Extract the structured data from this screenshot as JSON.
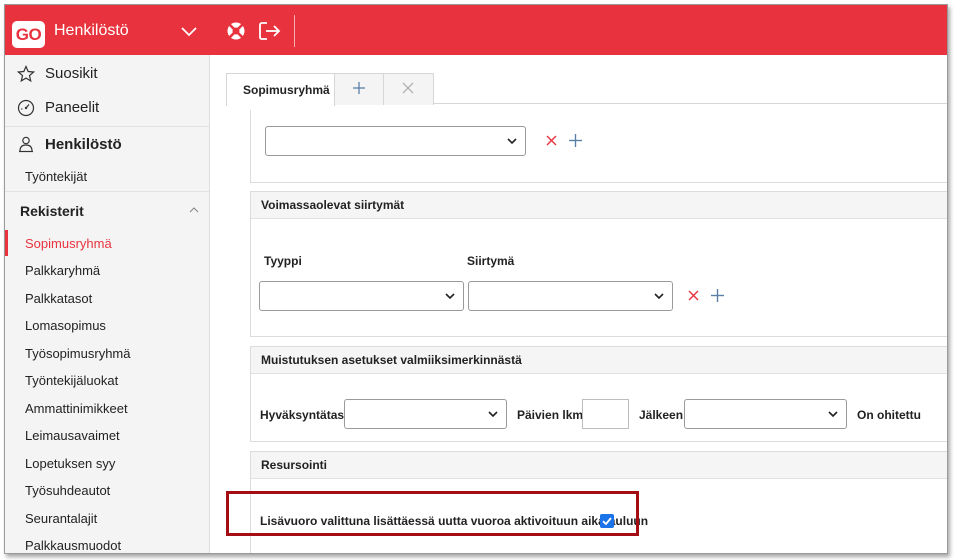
{
  "header": {
    "logo": "GO",
    "app_title": "Henkilöstö",
    "icons": [
      "chevron-down-icon",
      "lifebuoy-icon",
      "logout-icon"
    ]
  },
  "sidebar": {
    "top_items": [
      {
        "label": "Suosikit",
        "icon": "star-icon"
      },
      {
        "label": "Paneelit",
        "icon": "dashboard-icon"
      }
    ],
    "module": {
      "label": "Henkilöstö",
      "icon": "people-icon"
    },
    "module_items": [
      "Työntekijät"
    ],
    "section": {
      "label": "Rekisterit",
      "expanded": true
    },
    "items": [
      {
        "label": "Sopimusryhmä",
        "active": true
      },
      {
        "label": "Palkkaryhmä"
      },
      {
        "label": "Palkkatasot"
      },
      {
        "label": "Lomasopimus"
      },
      {
        "label": "Työsopimusryhmä"
      },
      {
        "label": "Työntekijäluokat"
      },
      {
        "label": "Ammattinimikkeet"
      },
      {
        "label": "Leimausavaimet"
      },
      {
        "label": "Lopetuksen syy"
      },
      {
        "label": "Työsuhdeautot"
      },
      {
        "label": "Seurantalajit"
      },
      {
        "label": "Palkkausmuodot"
      }
    ]
  },
  "tabs": [
    {
      "label": "Sopimusryhmä",
      "active": true
    },
    {
      "icon": "plus-icon"
    },
    {
      "icon": "close-icon"
    }
  ],
  "panels": {
    "top": {
      "select_value": ""
    },
    "transitions": {
      "title": "Voimassaolevat siirtymät",
      "type_label": "Tyyppi",
      "transition_label": "Siirtymä",
      "type_value": "",
      "transition_value": ""
    },
    "reminder": {
      "title": "Muistutuksen asetukset valmiiksimerkinnästä",
      "approval_label": "Hyväksyntätaso",
      "days_label": "Päivien lkm",
      "after_label": "Jälkeen",
      "skipped_label": "On ohitettu",
      "approval_value": "",
      "days_value": "",
      "after_value": ""
    },
    "resourcing": {
      "title": "Resursointi",
      "checkbox_label": "Lisävuoro valittuna lisättäessä uutta vuoroa aktivoituun aikatauluun",
      "checked": true
    }
  },
  "colors": {
    "brand": "#e8333f",
    "highlight": "#a50d14",
    "checkbox": "#1a73e8"
  }
}
